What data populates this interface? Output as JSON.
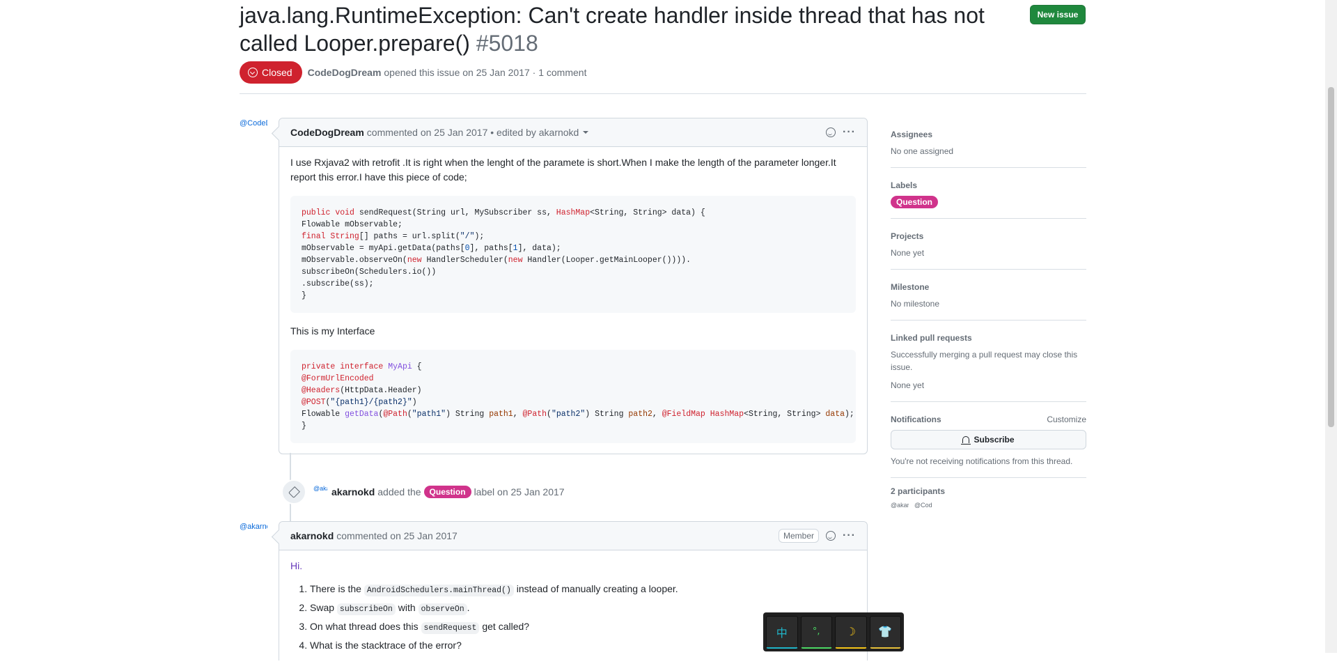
{
  "issue": {
    "title": "java.lang.RuntimeException: Can't create handler inside thread that has not called Looper.prepare()",
    "number": "#5018",
    "new_issue_label": "New issue",
    "state": "Closed",
    "author": "CodeDogDream",
    "opened_text": "opened this issue on 25 Jan 2017 · 1 comment"
  },
  "comment1": {
    "avatar_alt": "@CodeDogDream",
    "author": "CodeDogDream",
    "meta": "commented on 25 Jan 2017 • edited by akarnokd",
    "body_p1": "I use Rxjava2 with retrofit .It is right when the lenght of the paramete is short.When I make the length of the parameter longer.It report this error.I have this piece of code;",
    "body_p2": "This is my Interface"
  },
  "event": {
    "avatar_alt": "@akarnokd",
    "actor": "akarnokd",
    "pre": "added the",
    "label": "Question",
    "post": "label on 25 Jan 2017"
  },
  "comment2": {
    "avatar_alt": "@akarnokd",
    "author": "akarnokd",
    "meta": "commented on 25 Jan 2017",
    "badge": "Member",
    "greeting": "Hi.",
    "items": [
      {
        "pre": "There is the ",
        "code": "AndroidSchedulers.mainThread()",
        "post": " instead of manually creating a looper."
      },
      {
        "pre": "Swap ",
        "code": "subscribeOn",
        "mid": " with ",
        "code2": "observeOn",
        "post": "."
      },
      {
        "pre": "On what thread does this ",
        "code": "sendRequest",
        "post": " get called?"
      },
      {
        "pre": "What is the stacktrace of the error?"
      }
    ]
  },
  "sidebar": {
    "assignees_h": "Assignees",
    "assignees_v": "No one assigned",
    "labels_h": "Labels",
    "label": "Question",
    "projects_h": "Projects",
    "projects_v": "None yet",
    "milestone_h": "Milestone",
    "milestone_v": "No milestone",
    "linked_h": "Linked pull requests",
    "linked_desc": "Successfully merging a pull request may close this issue.",
    "linked_v": "None yet",
    "notif_h": "Notifications",
    "customize": "Customize",
    "subscribe": "Subscribe",
    "notif_v": "You're not receiving notifications from this thread.",
    "participants_h": "2 participants",
    "participant_alts": [
      "@akarnokd",
      "@CodeDogDream"
    ]
  },
  "ime": {
    "keys": [
      "中",
      "°,",
      "☽",
      "👕"
    ]
  },
  "colors": {
    "closed": "#cf222e",
    "new_issue": "#1f883d",
    "label_question": "#d0338b"
  }
}
